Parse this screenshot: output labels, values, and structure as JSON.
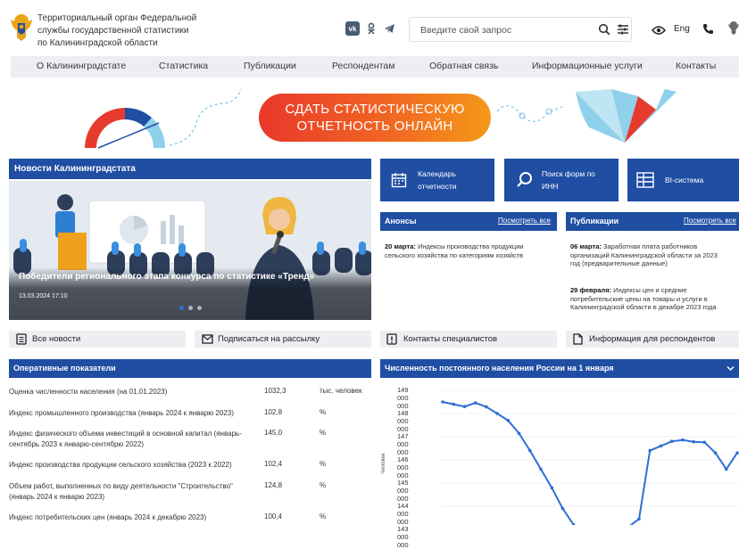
{
  "header": {
    "org_line1": "Территориальный орган Федеральной",
    "org_line2": "службы государственной статистики",
    "org_line3": "по Калининградской области",
    "search_placeholder": "Введите свой запрос",
    "lang": "Eng"
  },
  "nav": {
    "items": [
      "О Калининградстате",
      "Статистика",
      "Публикации",
      "Респондентам",
      "Обратная связь",
      "Информационные услуги",
      "Контакты"
    ]
  },
  "banner": {
    "line1": "СДАТЬ СТАТИСТИЧЕСКУЮ",
    "line2": "ОТЧЕТНОСТЬ ОНЛАЙН"
  },
  "news": {
    "header": "Новости Калининградстата",
    "title": "Победители регионального этапа конкурса по статистике «Тренд»",
    "date": "13.03.2024 17:10"
  },
  "tiles": [
    {
      "line1": "Календарь",
      "line2": "отчетности"
    },
    {
      "line1": "Поиск форм по",
      "line2": "ИНН"
    },
    {
      "line1": "BI-система",
      "line2": ""
    }
  ],
  "announcements": {
    "header": "Анонсы",
    "more": "Посмотреть все",
    "items": [
      {
        "date": "20 марта:",
        "l1": " Индексы производства продукции",
        "l2": "сельского хозяйства по категориям хозяйств"
      }
    ]
  },
  "publications": {
    "header": "Публикации",
    "more": "Посмотреть все",
    "items": [
      {
        "date": "06 марта:",
        "l1": " Заработная плата работников",
        "l2": "организаций Калининградской области за 2023",
        "l3": "год (предварительные данные)"
      },
      {
        "date": "29 февраля:",
        "l1": " Индексы цен и средние",
        "l2": "потребительские цены на товары и услуги в",
        "l3": "Калининградской области в декабре 2023 года"
      }
    ]
  },
  "buttons": {
    "all_news": "Все новости",
    "subscribe": "Подписаться на рассылку",
    "contacts": "Контакты специалистов",
    "respondents": "Информация для респондентов"
  },
  "indicators": {
    "header": "Оперативные показатели",
    "rows": [
      {
        "l1": "Оценка численности населения (на 01.01.2023)",
        "l2": "",
        "value": "1032,3",
        "unit": "тыс. человек"
      },
      {
        "l1": "Индекс промышленного производства (январь 2024 к январю 2023)",
        "l2": "",
        "value": "102,8",
        "unit": "%"
      },
      {
        "l1": "Индекс физического объема инвестиций в основной капитал (январь-",
        "l2": "сентябрь 2023 к январю-сентябрю 2022)",
        "value": "145,0",
        "unit": "%"
      },
      {
        "l1": "Индекс производства продукции сельского хозяйства (2023 к 2022)",
        "l2": "",
        "value": "102,4",
        "unit": "%"
      },
      {
        "l1": "Объем работ, выполненных по виду деятельности \"Строительство\"",
        "l2": "(январь 2024 к январю 2023)",
        "value": "124,8",
        "unit": "%"
      },
      {
        "l1": "Индекс потребительских цен (январь 2024 к декабрю 2023)",
        "l2": "",
        "value": "100,4",
        "unit": "%"
      }
    ]
  },
  "chart_data": {
    "type": "line",
    "title": "Численность постоянного населения России на 1 января",
    "ylabel": "Человек",
    "ylim": [
      143000000,
      149000000
    ],
    "yticks": [
      "149 000 000",
      "148 000 000",
      "147 000 000",
      "146 000 000",
      "145 000 000",
      "144 000 000",
      "143 000 000"
    ],
    "series": [
      {
        "values": [
          148500000,
          148400000,
          148300000,
          148460000,
          148290000,
          148000000,
          147700000,
          147140000,
          146400000,
          145600000,
          144800000,
          143900000,
          143200000,
          142900000,
          142700000,
          142750000,
          142850000,
          143100000,
          143450000,
          146400000,
          146600000,
          146800000,
          146860000,
          146780000,
          146760000,
          146300000,
          145600000,
          146300000
        ]
      }
    ],
    "color": "#2e6fd6"
  }
}
